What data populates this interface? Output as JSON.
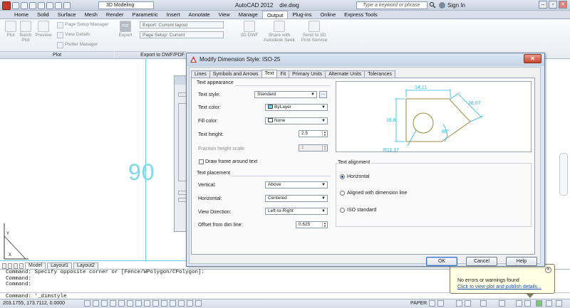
{
  "titlebar": {
    "workspace": "3D Modeling",
    "app_name": "AutoCAD 2012",
    "file_name": "die.dwg",
    "search_placeholder": "Type a keyword or phrase",
    "sign_in": "Sign In",
    "window_buttons": [
      "–",
      "▫",
      "✕"
    ]
  },
  "ribbon": {
    "tabs": [
      "Home",
      "Solid",
      "Surface",
      "Mesh",
      "Render",
      "Parametric",
      "Insert",
      "Annotate",
      "View",
      "Manage",
      "Output",
      "Plug-ins",
      "Online",
      "Express Tools"
    ],
    "active_tab": "Output",
    "plot_panel": {
      "title": "Plot",
      "plot": "Plot",
      "batch_plot": "Batch\nPlot",
      "preview": "Preview",
      "page_setup_manager": "Page Setup Manager",
      "view_details": "View Details",
      "plotter_manager": "Plotter Manager"
    },
    "export_panel": {
      "title": "Export to DWF/PDF",
      "export": "Export",
      "pdf_icon": "PDF",
      "export_layout": "Export: Current layout",
      "page_setup": "Page Setup: Current"
    },
    "dwf_3d": "3D DWF",
    "share_autodesk_seek": "Share with\nAutodesk Seek",
    "send_3d_print": "Send to 3D\nPrint Service"
  },
  "drawing": {
    "dim_text": "90",
    "layout_tabs": [
      "Model",
      "Layout1",
      "Layout2"
    ],
    "active_layout": "Model"
  },
  "command": {
    "lines": [
      "Command: Specify opposite corner or [Fence/WPolygon/CPolygon]:",
      "Command:",
      "Command:",
      "",
      "Command: '_dimstyle"
    ]
  },
  "statusbar": {
    "coordinates": "203.1755, 173.7112, 0.0000",
    "paper": "PAPER"
  },
  "balloon": {
    "message": "No errors or warnings found",
    "link": "Click to view plot and publish details..."
  },
  "dialog": {
    "title": "Modify Dimension Style: ISO-25",
    "tabs": [
      "Lines",
      "Symbols and Arrows",
      "Text",
      "Fit",
      "Primary Units",
      "Alternate Units",
      "Tolerances"
    ],
    "active_tab": "Text",
    "text_appearance": {
      "title": "Text appearance",
      "text_style_label": "Text style:",
      "text_style": "Standard",
      "ellipsis": "...",
      "text_color_label": "Text color:",
      "text_color": "ByLayer",
      "text_color_swatch": "#5ad8ef",
      "fill_color_label": "Fill color:",
      "fill_color": "None",
      "fill_color_swatch": "#ffffff",
      "text_height_label": "Text height:",
      "text_height": "2.5",
      "fraction_height_label": "Fraction height scale:",
      "fraction_height": "1",
      "draw_frame_label": "Draw frame around text",
      "draw_frame_checked": false
    },
    "text_placement": {
      "title": "Text placement",
      "vertical_label": "Vertical:",
      "vertical": "Above",
      "horizontal_label": "Horizontal:",
      "horizontal": "Centered",
      "view_direction_label": "View Direction:",
      "view_direction": "Left-to-Right",
      "offset_label": "Offset from dim line:",
      "offset": "0.625"
    },
    "text_alignment": {
      "title": "Text alignment",
      "options": [
        "Horizontal",
        "Aligned with dimension line",
        "ISO standard"
      ],
      "selected": "Horizontal"
    },
    "preview": {
      "dim_top": "14,11",
      "dim_left": "16,6",
      "dim_right": "28,07",
      "dim_angle": "80°",
      "dim_radius": "R11,17",
      "dim_color": "#1fb6e0",
      "geometry_color": "#a08a3c"
    },
    "buttons": {
      "ok": "OK",
      "cancel": "Cancel",
      "help": "Help"
    }
  }
}
